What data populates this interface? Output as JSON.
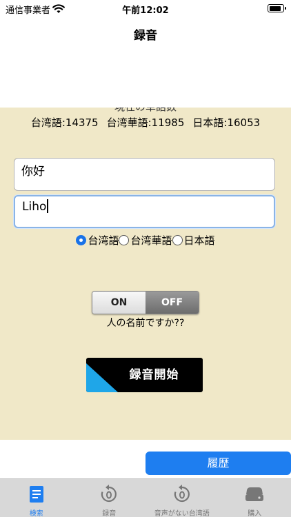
{
  "status_bar": {
    "carrier": "通信事業者",
    "time": "午前12:02",
    "battery_level": 0.9
  },
  "nav": {
    "title": "録音"
  },
  "counts": {
    "header": "現在の単語数",
    "taiwanese": "台湾語:14375",
    "taiwan_mandarin": "台湾華語:11985",
    "japanese": "日本語:16053"
  },
  "fields": {
    "first_value": "你好",
    "second_value": "Liho"
  },
  "language_options": [
    {
      "label": "台湾語",
      "checked": true
    },
    {
      "label": "台湾華語",
      "checked": false
    },
    {
      "label": "日本語",
      "checked": false
    }
  ],
  "toggle": {
    "on_label": "ON",
    "off_label": "OFF",
    "state": "off",
    "question": "人の名前ですか??"
  },
  "record_button": {
    "label": "録音開始"
  },
  "history_button": {
    "label": "履歴"
  },
  "tabs": [
    {
      "label": "検索",
      "icon": "document-icon",
      "active": true
    },
    {
      "label": "録音",
      "icon": "replay-zero-icon",
      "active": false
    },
    {
      "label": "音声がない台湾語",
      "icon": "replay-zero-icon",
      "active": false
    },
    {
      "label": "購入",
      "icon": "storage-drive-icon",
      "active": false
    }
  ],
  "colors": {
    "panel_background": "#f0e8c8",
    "accent_blue": "#1e7ef0",
    "record_accent": "#1fa6e8",
    "tab_bar": "#d8d8d8"
  }
}
